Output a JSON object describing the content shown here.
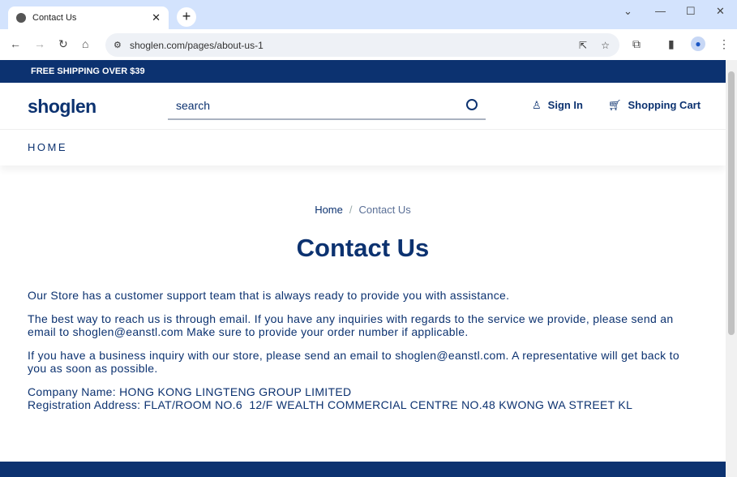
{
  "browser": {
    "tab_title": "Contact Us",
    "url": "shoglen.com/pages/about-us-1"
  },
  "site": {
    "banner": "FREE SHIPPING OVER $39",
    "logo": "shoglen",
    "search_placeholder": "search",
    "sign_in": "Sign In",
    "cart": "Shopping Cart",
    "nav": [
      "HOME"
    ]
  },
  "breadcrumb": {
    "home": "Home",
    "separator": "/",
    "current": "Contact Us"
  },
  "page": {
    "title": "Contact Us",
    "paragraphs": [
      "Our Store has a customer support team that is always ready to provide you with assistance.",
      "The best way to reach us is through email. If you have any inquiries with regards to the service we provide, please send an email to shoglen@eanstl.com Make sure to provide your order number if applicable.",
      "If you have a business inquiry with our store, please send an email to shoglen@eanstl.com. A representative will get back to you as soon as possible."
    ],
    "company": "Company Name: HONG KONG LINGTENG GROUP LIMITED",
    "address": "Registration Address: FLAT/ROOM NO.6  12/F WEALTH COMMERCIAL CENTRE NO.48 KWONG WA STREET KL"
  },
  "colors": {
    "brand": "#0c3270",
    "chrome": "#d3e3fd"
  }
}
